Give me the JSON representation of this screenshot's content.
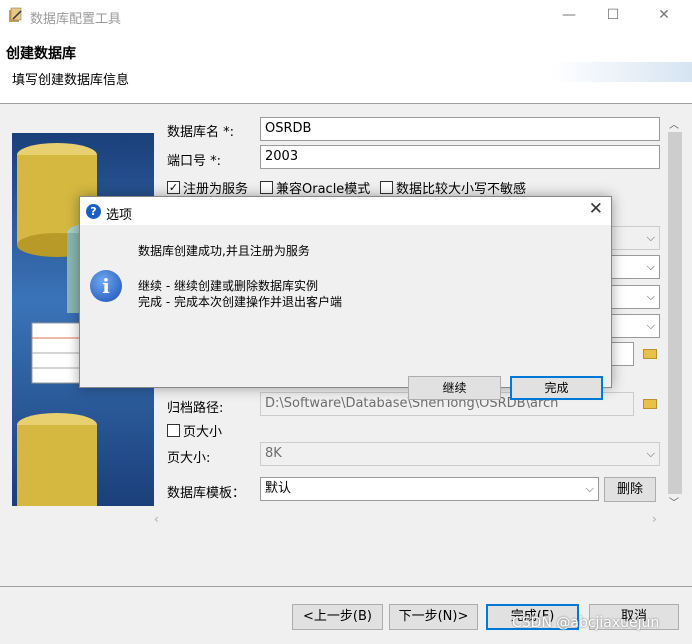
{
  "window": {
    "title": "数据库配置工具",
    "minimize": "—",
    "maximize": "☐",
    "close": "✕"
  },
  "header": {
    "title": "创建数据库",
    "subtitle": "填写创建数据库信息"
  },
  "form": {
    "db_name_label": "数据库名 *:",
    "db_name_value": "OSRDB",
    "port_label": "端口号 *:",
    "port_value": "2003",
    "cb_register": {
      "label": "注册为服务",
      "checked": true
    },
    "cb_oracle": {
      "label": "兼容Oracle模式",
      "checked": false
    },
    "cb_case": {
      "label": "数据比较大小写不敏感",
      "checked": false
    },
    "archive_label": "归档路径:",
    "archive_value": "D:\\Software\\Database\\ShenTong\\OSRDB\\arch",
    "cb_pagesize": {
      "label": "页大小",
      "checked": false
    },
    "pagesize_label": "页大小:",
    "pagesize_value": "8K",
    "template_label": "数据库模板：",
    "template_value": "默认",
    "delete_button": "删除"
  },
  "footer": {
    "prev": "<上一步(B)",
    "next": "下一步(N)>",
    "finish": "完成(F)",
    "cancel": "取消"
  },
  "dialog": {
    "title": "选项",
    "close": "✕",
    "line1": "数据库创建成功,并且注册为服务",
    "line2": "继续 - 继续创建或删除数据库实例",
    "line3": "完成 - 完成本次创建操作并退出客户端",
    "continue_button": "继续",
    "finish_button": "完成"
  },
  "watermark": "CSDN @abcjiaxuejun",
  "colors": {
    "accent": "#0078d7",
    "info_icon": "#1a5fc1"
  }
}
